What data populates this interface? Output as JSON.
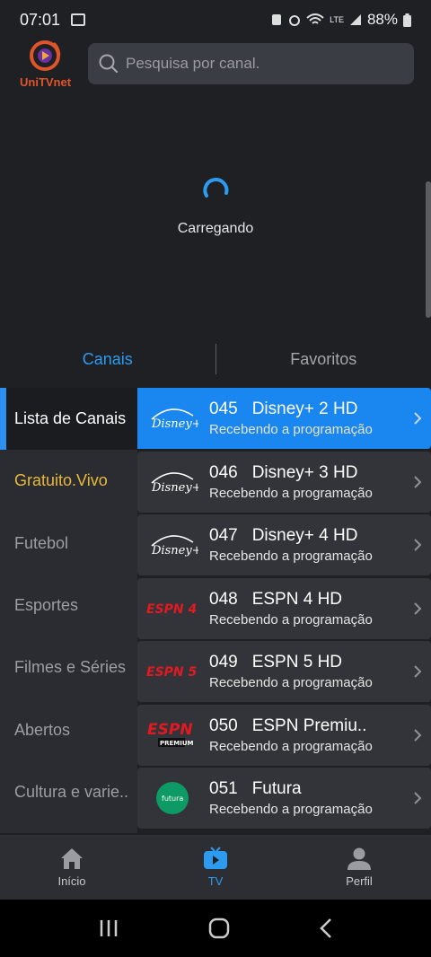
{
  "status_bar": {
    "time": "07:01",
    "battery": "88%",
    "network": "LTE"
  },
  "app": {
    "logo_text": "UniTVnet"
  },
  "search": {
    "placeholder": "Pesquisa por canal."
  },
  "loading": {
    "text": "Carregando"
  },
  "tabs": [
    {
      "label": "Canais",
      "active": true
    },
    {
      "label": "Favoritos",
      "active": false
    }
  ],
  "categories": [
    {
      "label": "Lista de Canais",
      "selected": true
    },
    {
      "label": "Gratuito.Vivo",
      "highlight": true
    },
    {
      "label": "Futebol"
    },
    {
      "label": "Esportes"
    },
    {
      "label": "Filmes e Séries"
    },
    {
      "label": "Abertos"
    },
    {
      "label": "Cultura e varie.."
    }
  ],
  "channels": [
    {
      "number": "045",
      "name": "Disney+ 2 HD",
      "status": "Recebendo a programação",
      "logo": "disney-plus",
      "active": true
    },
    {
      "number": "046",
      "name": "Disney+ 3 HD",
      "status": "Recebendo a programação",
      "logo": "disney-plus"
    },
    {
      "number": "047",
      "name": "Disney+ 4 HD",
      "status": "Recebendo a programação",
      "logo": "disney-plus"
    },
    {
      "number": "048",
      "name": "ESPN 4 HD",
      "status": "Recebendo a programação",
      "logo": "espn-4"
    },
    {
      "number": "049",
      "name": "ESPN 5 HD",
      "status": "Recebendo a programação",
      "logo": "espn-5"
    },
    {
      "number": "050",
      "name": "ESPN Premiu..",
      "status": "Recebendo a programação",
      "logo": "espn-premium"
    },
    {
      "number": "051",
      "name": "Futura",
      "status": "Recebendo a programação",
      "logo": "futura"
    }
  ],
  "bottom_nav": [
    {
      "label": "Início",
      "icon": "home-icon"
    },
    {
      "label": "TV",
      "icon": "tv-icon",
      "active": true
    },
    {
      "label": "Perfil",
      "icon": "profile-icon"
    }
  ],
  "colors": {
    "accent": "#2d9bf0",
    "highlight": "#e9b93a",
    "background": "#1e2024"
  },
  "logos": {
    "espn": "ESPN",
    "espn4": "ESPN 4",
    "espn5": "ESPN 5",
    "premium": "PREMIUM",
    "futura": "futura",
    "disney": "Disney+"
  }
}
